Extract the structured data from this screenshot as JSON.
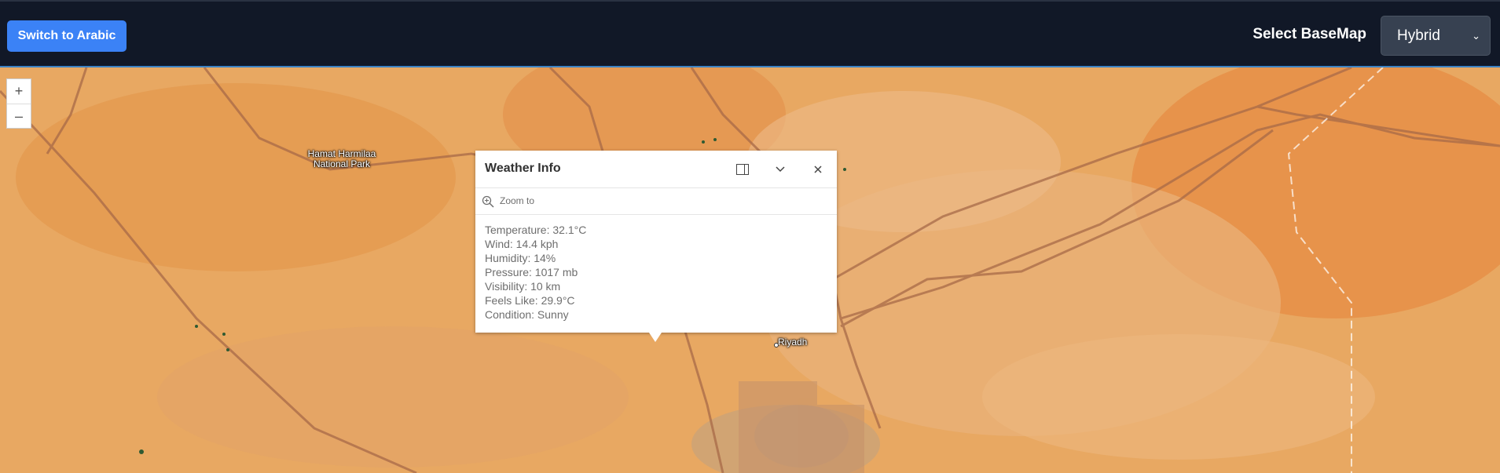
{
  "header": {
    "switch_label": "Switch to Arabic",
    "basemap_label": "Select BaseMap",
    "basemap_selected": "Hybrid"
  },
  "map": {
    "zoom_in": "+",
    "zoom_out": "–",
    "places": {
      "park": "Hamat Harmilaa\nNational Park",
      "city": "Riyadh"
    }
  },
  "popup": {
    "title": "Weather Info",
    "zoom_to": "Zoom to",
    "lines": [
      "Temperature: 32.1°C",
      "Wind: 14.4 kph",
      "Humidity: 14%",
      "Pressure: 1017 mb",
      "Visibility: 10 km",
      "Feels Like: 29.9°C",
      "Condition: Sunny"
    ]
  },
  "colors": {
    "header_bg": "#111827",
    "button_blue": "#3b82f6",
    "select_bg": "#374151",
    "sand": "#e6a05c"
  }
}
